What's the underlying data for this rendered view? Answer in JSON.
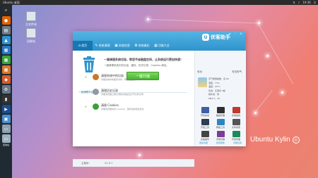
{
  "topbar": {
    "title": "Ubuntu 桌面",
    "time": "19:36"
  },
  "launcher": {
    "items": [
      {
        "icon": "dash-icon",
        "color": "#2b2b2b",
        "glyph": "⌕"
      },
      {
        "icon": "firefox-icon",
        "color": "#e66000",
        "glyph": "●"
      },
      {
        "icon": "files-icon",
        "color": "#6f7a86",
        "glyph": "▤"
      },
      {
        "icon": "kylin-assistant-icon",
        "color": "#2f93cc",
        "glyph": "▲"
      },
      {
        "icon": "document-icon",
        "color": "#2a79c9",
        "glyph": "▦"
      },
      {
        "icon": "spreadsheet-icon",
        "color": "#3ba53b",
        "glyph": "▦"
      },
      {
        "icon": "presentation-icon",
        "color": "#d9782b",
        "glyph": "▦"
      },
      {
        "icon": "software-center-icon",
        "color": "#d95b2b",
        "glyph": "◆"
      },
      {
        "icon": "settings-icon",
        "color": "#6a7784",
        "glyph": "⚙"
      },
      {
        "icon": "terminal-icon",
        "color": "#333333",
        "glyph": "▮"
      },
      {
        "icon": "video-icon",
        "color": "#1a4d8f",
        "glyph": "▶"
      },
      {
        "icon": "workspace-icon",
        "color": "#4a8fd0",
        "glyph": "▣"
      },
      {
        "icon": "storage-icon",
        "color": "#8ea0b0",
        "glyph": "▭"
      },
      {
        "icon": "trash-icon",
        "color": "#9fb0bd",
        "glyph": "▭"
      }
    ],
    "bottom_label": "回收站"
  },
  "desktop": {
    "icons": [
      {
        "label": "主文件夹"
      },
      {
        "label": "回收站"
      }
    ]
  },
  "window": {
    "logo_text": "优客助手",
    "tabs": [
      {
        "label": "首页",
        "icon": "home-icon",
        "glyph": "⌂"
      },
      {
        "label": "系统清理",
        "icon": "broom-icon",
        "glyph": "✎"
      },
      {
        "label": "系统信息",
        "icon": "monitor-icon",
        "glyph": "▣"
      },
      {
        "label": "系统美化",
        "icon": "palette-icon",
        "glyph": "✿"
      },
      {
        "label": "功能大全",
        "icon": "grid-icon",
        "glyph": "▦"
      }
    ],
    "lead_title": "一键清理系统垃圾，帮您节省磁盘空间，让系统运行更加快速！",
    "lead_desc": "一键清理系统中的垃圾、缓存、历史记录、Cookies 和包。",
    "start_label": "一键扫描",
    "section_title": "一键清理项目",
    "items": [
      {
        "title": "清理系统中的垃圾",
        "desc": "清理系统中的缓存文件，释放磁盘空间",
        "color": "#c9772d"
      },
      {
        "title": "清理历史记录",
        "desc": "清理浏览器上网记录和系统最近打开文件记录",
        "color": "#8f9aa4"
      },
      {
        "title": "清理 Cookies",
        "desc": "清理浏览器中的 Cookies，保护您的隐私安全",
        "color": "#3aa039"
      }
    ],
    "status_left": "主程序：",
    "status_right": "V1.0.1"
  },
  "side": {
    "label_left": "长沙",
    "label_right": "今日天气",
    "weather_lines": [
      "空气质量指数：良 84",
      "湿度：77%",
      "温度：23°C",
      "风向：东南风 3级",
      "紫外线：弱",
      "PM2.5：34"
    ],
    "apps": [
      {
        "label": "开机启动",
        "color": "#3f5ea8"
      },
      {
        "label": "磁盘管理",
        "color": "#2f2f2f"
      },
      {
        "label": "系统监视",
        "color": "#c0392b"
      },
      {
        "label": "开发工具",
        "color": "#2c3e50"
      },
      {
        "label": "网络工具",
        "color": "#2e86c1"
      },
      {
        "label": "文件搜索",
        "color": "#555555"
      },
      {
        "label": "系统备份",
        "color": "#444444"
      },
      {
        "label": "字体管理",
        "color": "#7d3c98"
      },
      {
        "label": "声音管理",
        "color": "#1b8a5a"
      }
    ],
    "footer": [
      "更多功能",
      "检查更新",
      "问题反馈"
    ]
  },
  "brand": {
    "text": "Ubuntu Kylin",
    "mark": "◎"
  }
}
